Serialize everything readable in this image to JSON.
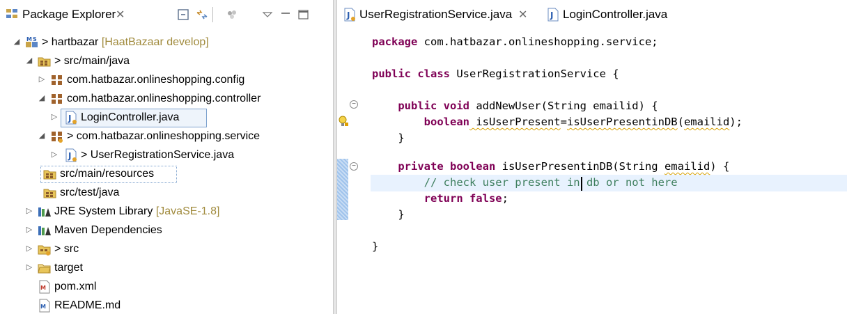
{
  "explorer": {
    "title": "Package Explorer",
    "close_glyph": "✕",
    "tree": [
      {
        "label": "> hartbazar",
        "decoration": "[HaatBazaar develop]",
        "icon": "maven-project-icon",
        "twisty": "expanded"
      },
      {
        "label": "> src/main/java",
        "decoration": "",
        "icon": "source-folder-icon",
        "twisty": "expanded"
      },
      {
        "label": "com.hatbazar.onlineshopping.config",
        "decoration": "",
        "icon": "package-icon",
        "twisty": "collapsed"
      },
      {
        "label": "com.hatbazar.onlineshopping.controller",
        "decoration": "",
        "icon": "package-icon",
        "twisty": "expanded"
      },
      {
        "label": "LoginController.java",
        "decoration": "",
        "icon": "java-file-icon",
        "twisty": "collapsed"
      },
      {
        "label": "> com.hatbazar.onlineshopping.service",
        "decoration": "",
        "icon": "package-icon",
        "twisty": "expanded"
      },
      {
        "label": "> UserRegistrationService.java",
        "decoration": "",
        "icon": "java-file-icon",
        "twisty": "collapsed"
      },
      {
        "label": "src/main/resources",
        "decoration": "",
        "icon": "source-folder-icon",
        "twisty": "none"
      },
      {
        "label": "src/test/java",
        "decoration": "",
        "icon": "source-folder-icon",
        "twisty": "none"
      },
      {
        "label": "JRE System Library",
        "decoration": "[JavaSE-1.8]",
        "icon": "library-icon",
        "twisty": "collapsed"
      },
      {
        "label": "Maven Dependencies",
        "decoration": "",
        "icon": "library-icon",
        "twisty": "collapsed"
      },
      {
        "label": "> src",
        "decoration": "",
        "icon": "folder-icon",
        "twisty": "collapsed"
      },
      {
        "label": "target",
        "decoration": "",
        "icon": "folder-icon",
        "twisty": "collapsed"
      },
      {
        "label": "pom.xml",
        "decoration": "",
        "icon": "xml-file-icon",
        "twisty": "none"
      },
      {
        "label": "README.md",
        "decoration": "",
        "icon": "md-file-icon",
        "twisty": "none"
      }
    ]
  },
  "editor": {
    "tabs": [
      {
        "label": "UserRegistrationService.java",
        "active": true,
        "close_glyph": "✕"
      },
      {
        "label": "LoginController.java",
        "active": false
      }
    ],
    "code": {
      "l1": "package com.hatbazar.onlineshopping.service;",
      "l3a": "public class",
      "l3b": " UserRegistrationService {",
      "l5a": "    public void",
      "l5b": " addNewUser(String emailid) {",
      "l6a": "        boolean",
      "l6b": " isUserPresent",
      "l6c": "=",
      "l6d": "isUserPresentinDB",
      "l6e": "(",
      "l6f": "emailid",
      "l6g": ");",
      "l7": "    }",
      "l9a": "    private boolean",
      "l9b": " isUserPresentinDB(String ",
      "l9c": "emailid",
      "l9d": ") {",
      "l10": "        // check user present in db or not here",
      "l11a": "        return false",
      "l11b": ";",
      "l12": "    }",
      "l14": "}"
    }
  },
  "colors": {
    "keyword": "#7f0055",
    "comment": "#3f7f5f",
    "decoration": "#a08a3c",
    "selection": "#7da2ce"
  }
}
